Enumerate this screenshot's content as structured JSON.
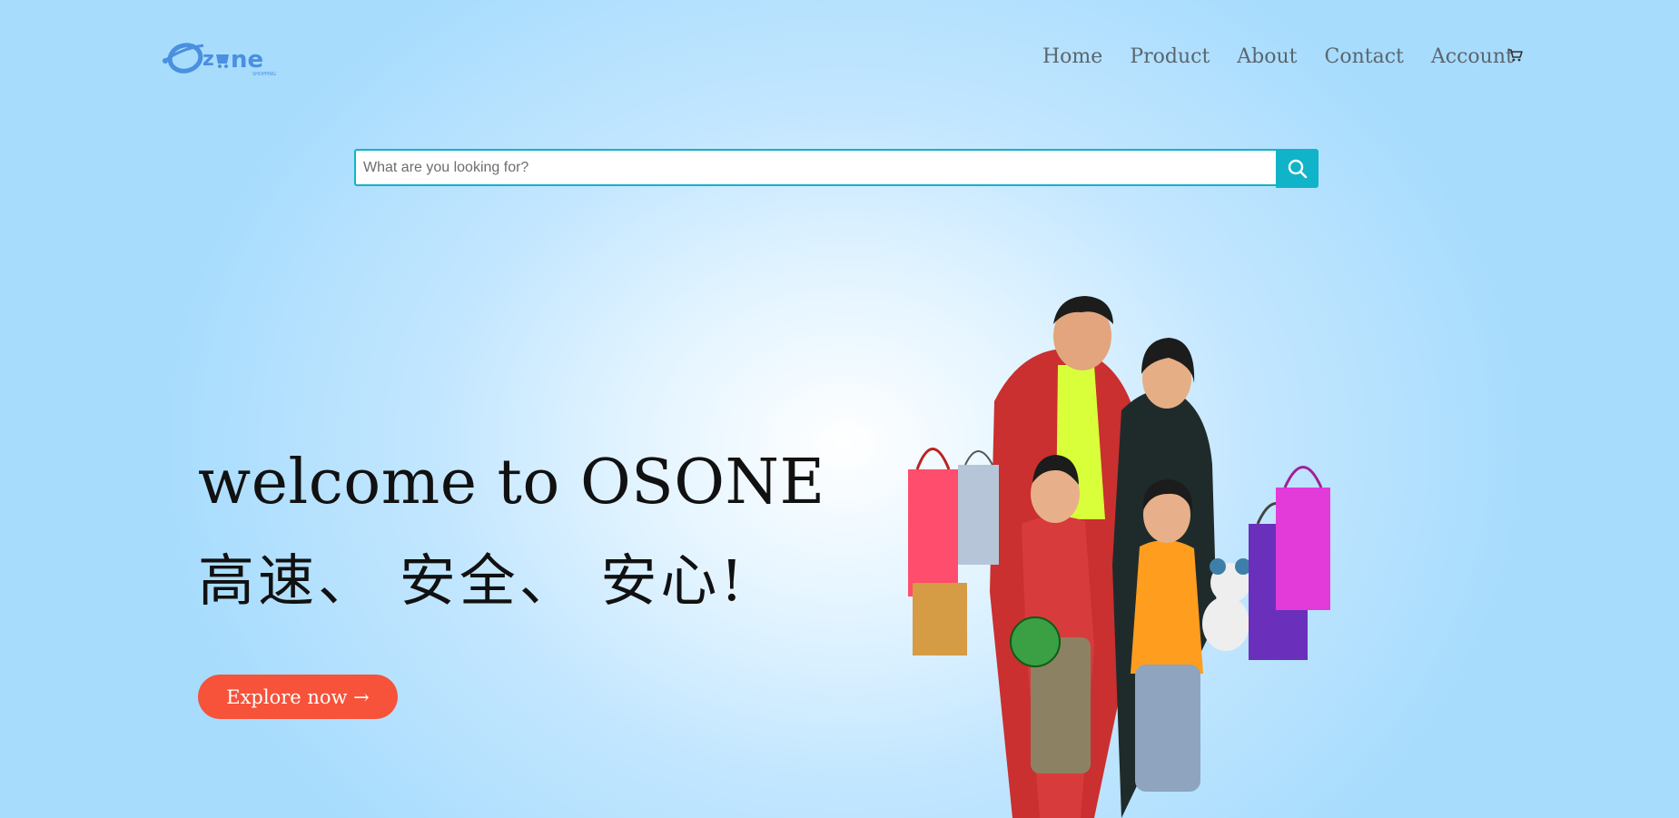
{
  "logo": {
    "main": "Ozone",
    "tagline": "SHOPPING"
  },
  "nav": {
    "items": [
      "Home",
      "Product",
      "About",
      "Contact",
      "Account"
    ],
    "cart_icon": "cart-icon"
  },
  "search": {
    "placeholder": "What are you looking for?",
    "value": "",
    "button_icon": "search-icon"
  },
  "hero": {
    "title": "welcome to OSONE",
    "subtitle": "高速、 安全、 安心!",
    "cta": "Explore now →",
    "image": "family-shopping-photo"
  },
  "colors": {
    "accent": "#11b3c9",
    "cta": "#f7523a",
    "logo": "#4a8fe0",
    "nav_text": "#5a6670"
  }
}
